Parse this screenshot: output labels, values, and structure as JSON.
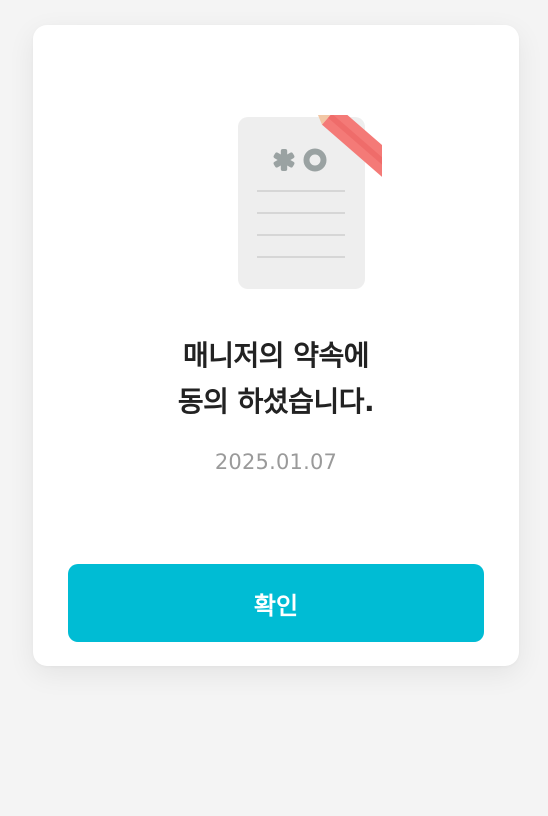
{
  "dialog": {
    "title_line1": "매니저의 약속에",
    "title_line2": "동의 하셨습니다.",
    "date": "2025.01.07",
    "confirm_label": "확인"
  },
  "colors": {
    "background": "#f4f4f4",
    "card": "#ffffff",
    "accent": "#00bcd4",
    "title": "#222222",
    "date": "#9a9a9a"
  },
  "icons": {
    "illustration": "document-with-pencil-icon"
  }
}
